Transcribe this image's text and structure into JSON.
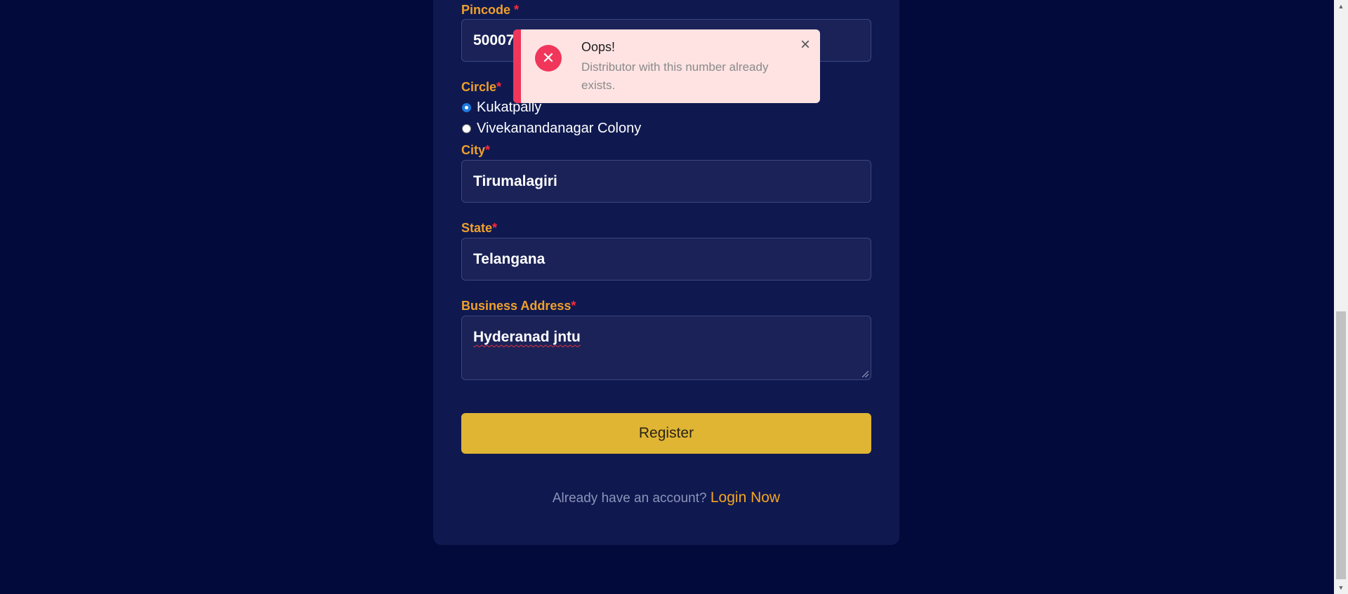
{
  "form": {
    "pincode": {
      "label": "Pincode",
      "required_mark": "*",
      "value": "50007"
    },
    "circle": {
      "label": "Circle",
      "required_mark": "*",
      "options": [
        {
          "label": "Kukatpally",
          "selected": true
        },
        {
          "label": "Vivekanandanagar Colony",
          "selected": false
        }
      ]
    },
    "city": {
      "label": "City",
      "required_mark": "*",
      "value": "Tirumalagiri"
    },
    "state": {
      "label": "State",
      "required_mark": "*",
      "value": "Telangana"
    },
    "business_address": {
      "label": "Business Address",
      "required_mark": "*",
      "value": "Hyderanad jntu"
    },
    "register_label": "Register",
    "footer": {
      "prompt": "Already have an account?",
      "link": "Login Now"
    }
  },
  "toast": {
    "icon": "error-x-icon",
    "title": "Oops!",
    "message": "Distributor with this number already exists.",
    "close_icon": "close-icon"
  },
  "colors": {
    "background": "#020a3c",
    "card": "#0f1950",
    "label": "#f0a02a",
    "required": "#ff2a3a",
    "button": "#e0b534",
    "toast_bg": "#ffe3e3",
    "toast_accent": "#f0365a"
  }
}
